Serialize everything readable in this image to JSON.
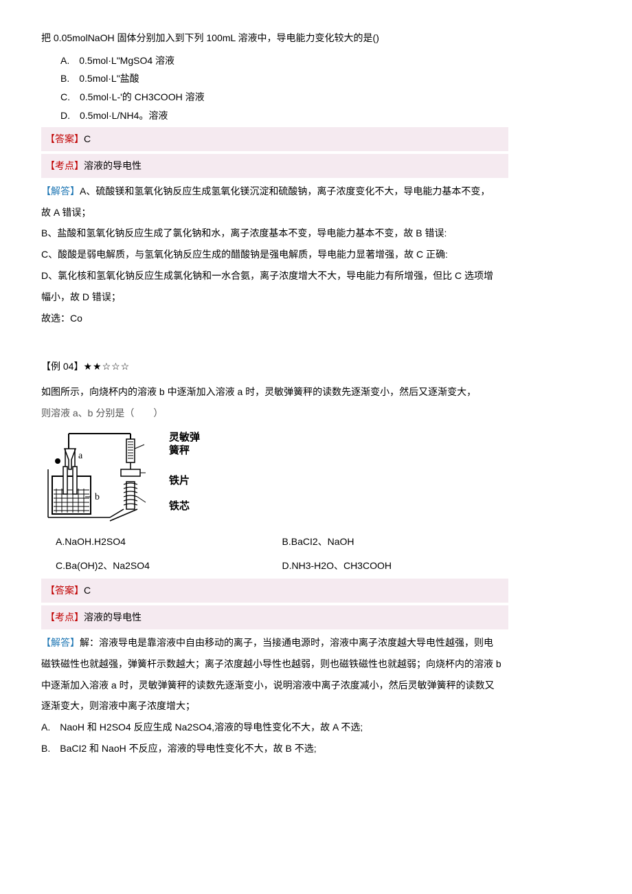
{
  "q1": {
    "stem": "把 0.05molNaOH 固体分别加入到下列 100mL 溶液中，导电能力变化较大的是()",
    "optA": "A.　0.5mol·L\"MgSO4 溶液",
    "optB": "B.　0.5mol·L\"盐酸",
    "optC": "C.　0.5mol·L-'的 CH3COOH 溶液",
    "optD": "D.　0.5mol·L/NH4。溶液",
    "ans_label": "【答案】",
    "ans_val": "C",
    "topic_label": "【考点】",
    "topic_val": "溶液的导电性",
    "exp_label": "【解答】",
    "expA": "A、硫酸镁和氢氧化钠反应生成氢氧化镁沉淀和硫酸钠，离子浓度变化不大，导电能力基本不变，",
    "expA2": "故 A 错误；",
    "expB": "B、盐酸和氢氧化钠反应生成了氯化钠和水，离子浓度基本不变，导电能力基本不变，故 B 错误:",
    "expC": "C、酸酸是弱电解质，与氢氧化钠反应生成的醋酸钠是强电解质，导电能力显著增强，故 C 正确:",
    "expD": "D、氯化核和氢氧化钠反应生成氯化钠和一水合氨，离子浓度增大不大，导电能力有所增强，但比 C 选项增",
    "expD2": "幅小，故 D 错误；",
    "expEnd": "故选：Co"
  },
  "q2": {
    "header": "【例 04】",
    "stars": "★★☆☆☆",
    "stem1": "如图所示，向烧杯内的溶液 b 中逐渐加入溶液 a 时，灵敏弹簧秤的读数先逐渐变小，然后又逐渐变大，",
    "stem2": "则溶液 a、b 分别是（　　）",
    "fig_a": "a",
    "fig_b": "b",
    "fig_l1a": "灵敏弹",
    "fig_l1b": "簧秤",
    "fig_l2": "铁片",
    "fig_l3": "铁芯",
    "optA": "A.NaOH.H2SO4",
    "optB": "B.BaCI2、NaOH",
    "optC": "C.Ba(OH)2、Na2SO4",
    "optD": "D.NH3-H2O、CH3COOH",
    "ans_label": "【答案】",
    "ans_val": "C",
    "topic_label": "【考点】",
    "topic_val": "溶液的导电性",
    "exp_label": "【解答】",
    "exp1": "解：溶液导电是靠溶液中自由移动的离子，当接通电源时，溶液中离子浓度越大导电性越强，则电",
    "exp2": "磁铁磁性也就越强，弹簧杆示数越大；离子浓度越小导性也越弱，则也磁铁磁性也就越弱；向烧杯内的溶液 b",
    "exp3": "中逐渐加入溶液 a 时，灵敏弹簧秤的读数先逐渐变小，说明溶液中离子浓度减小，然后灵敏弹簧秤的读数又",
    "exp4": "逐渐变大，则溶液中离子浓度增大；",
    "expA": "A.　NaoH 和 H2SO4 反应生成 Na2SO4,溶液的导电性变化不大，故 A 不选;",
    "expB": "B.　BaCI2 和 NaoH 不反应，溶液的导电性变化不大，故 B 不选;"
  }
}
